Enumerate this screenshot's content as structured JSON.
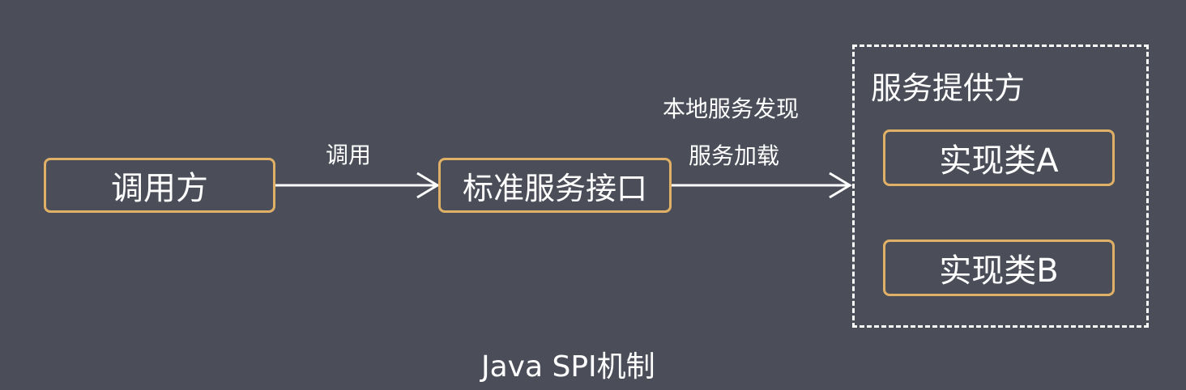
{
  "nodes": {
    "caller": "调用方",
    "interface": "标准服务接口",
    "impl_a": "实现类A",
    "impl_b": "实现类B"
  },
  "provider_group": {
    "title": "服务提供方"
  },
  "edges": {
    "call_label": "调用",
    "discovery_label": "本地服务发现",
    "load_label": "服务加载"
  },
  "caption": "Java SPI机制",
  "colors": {
    "background": "#4b4e59",
    "box_border": "#e0b067",
    "text": "#ffffff"
  }
}
